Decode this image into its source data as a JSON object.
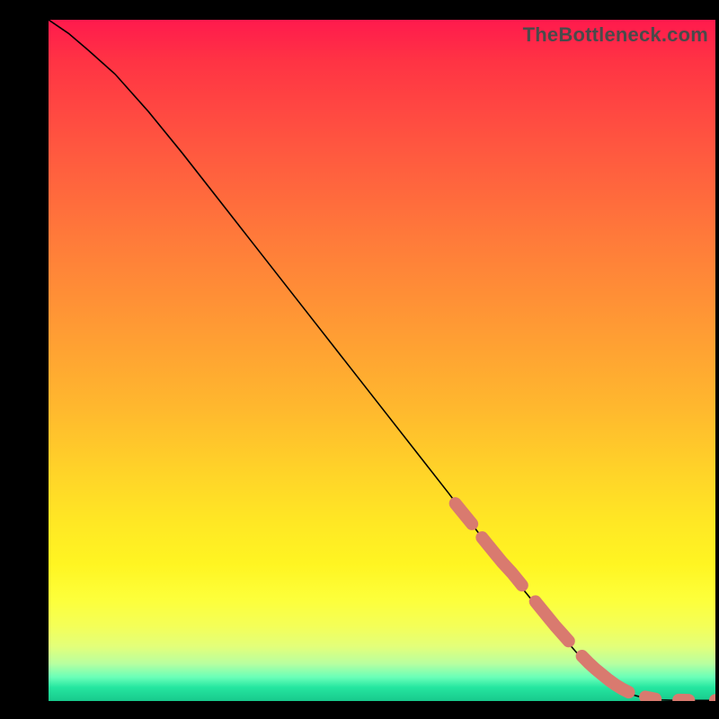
{
  "watermark": "TheBottleneck.com",
  "colors": {
    "dot": "#d97a6f",
    "curve": "#000000"
  },
  "chart_data": {
    "type": "line",
    "title": "",
    "xlabel": "",
    "ylabel": "",
    "xlim": [
      0,
      100
    ],
    "ylim": [
      0,
      100
    ],
    "grid": false,
    "legend": false,
    "series": [
      {
        "name": "curve",
        "style": "line",
        "x": [
          0,
          3,
          6,
          10,
          15,
          20,
          30,
          40,
          50,
          60,
          65,
          70,
          75,
          80,
          85,
          88,
          90,
          92,
          94,
          96,
          98,
          100
        ],
        "y": [
          100,
          98,
          95.5,
          92,
          86.5,
          80.5,
          68,
          55.5,
          43,
          30.5,
          24,
          17.8,
          11.8,
          6.2,
          2.0,
          0.8,
          0.3,
          0.15,
          0.1,
          0.1,
          0.1,
          0.1
        ]
      },
      {
        "name": "highlighted-points",
        "style": "scatter",
        "x": [
          61,
          62,
          63.5,
          65,
          66,
          67,
          68,
          69.5,
          71,
          73,
          74,
          75,
          76,
          77,
          78,
          80,
          81,
          82,
          83,
          84,
          85,
          86,
          87,
          89.5,
          91,
          94.5,
          96,
          100
        ],
        "y": [
          29,
          27.8,
          26,
          24,
          22.8,
          21.6,
          20.4,
          18.8,
          17,
          14.6,
          13.4,
          12.2,
          11,
          9.9,
          8.8,
          6.6,
          5.6,
          4.7,
          3.9,
          3.1,
          2.4,
          1.8,
          1.3,
          0.6,
          0.3,
          0.15,
          0.12,
          0.1
        ]
      }
    ],
    "note": "Axes have no tick labels; y-values estimated from geometry as percent of plot height."
  }
}
